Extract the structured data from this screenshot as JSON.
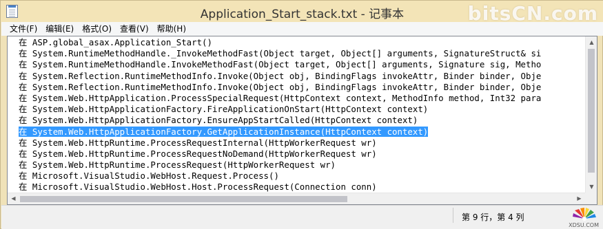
{
  "window": {
    "title": "Application_Start_stack.txt - 记事本",
    "watermark": "bitsCN.com"
  },
  "menu": [
    {
      "label": "文件(F)"
    },
    {
      "label": "编辑(E)"
    },
    {
      "label": "格式(O)"
    },
    {
      "label": "查看(V)"
    },
    {
      "label": "帮助(H)"
    }
  ],
  "editor": {
    "prefix": "在 ",
    "lines": [
      "ASP.global_asax.Application_Start()",
      "System.RuntimeMethodHandle._InvokeMethodFast(Object target, Object[] arguments, SignatureStruct& si",
      "System.RuntimeMethodHandle.InvokeMethodFast(Object target, Object[] arguments, Signature sig, Metho",
      "System.Reflection.RuntimeMethodInfo.Invoke(Object obj, BindingFlags invokeAttr, Binder binder, Obje",
      "System.Reflection.RuntimeMethodInfo.Invoke(Object obj, BindingFlags invokeAttr, Binder binder, Obje",
      "System.Web.HttpApplication.ProcessSpecialRequest(HttpContext context, MethodInfo method, Int32 para",
      "System.Web.HttpApplicationFactory.FireApplicationOnStart(HttpContext context)",
      "System.Web.HttpApplicationFactory.EnsureAppStartCalled(HttpContext context)",
      "System.Web.HttpApplicationFactory.GetApplicationInstance(HttpContext context)",
      "System.Web.HttpRuntime.ProcessRequestInternal(HttpWorkerRequest wr)",
      "System.Web.HttpRuntime.ProcessRequestNoDemand(HttpWorkerRequest wr)",
      "System.Web.HttpRuntime.ProcessRequest(HttpWorkerRequest wr)",
      "Microsoft.VisualStudio.WebHost.Request.Process()",
      "Microsoft.VisualStudio.WebHost.Host.ProcessRequest(Connection conn)"
    ],
    "selected_line": 8
  },
  "status": {
    "position": "第 9 行，第 4 列",
    "logo_text": "XDSU.COM"
  },
  "colors": {
    "selection": "#3399ff",
    "titlebar": "#f3e4b7"
  }
}
